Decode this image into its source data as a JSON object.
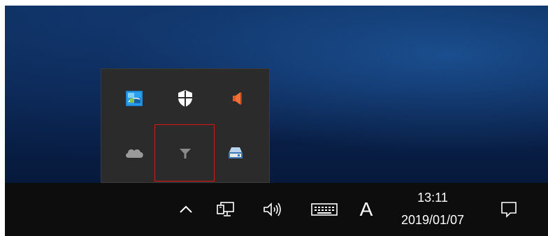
{
  "overflow_panel": {
    "icons": [
      {
        "name": "intel-graphics-icon"
      },
      {
        "name": "windows-security-icon"
      },
      {
        "name": "speaker-muted-icon"
      },
      {
        "name": "onedrive-cloud-icon"
      },
      {
        "name": "filter-icon",
        "highlighted": true
      },
      {
        "name": "removable-drive-icon"
      }
    ]
  },
  "taskbar": {
    "show_hidden_icons": "chevron-up-icon",
    "network": "network-icon",
    "volume": "volume-icon",
    "touch_keyboard": "keyboard-icon",
    "ime_mode": "A",
    "clock": {
      "time": "13:11",
      "date": "2019/01/07"
    },
    "action_center": "notification-icon"
  },
  "colors": {
    "taskbar_bg": "#0d0d0d",
    "panel_bg": "#2b2b2b",
    "highlight": "#e01414",
    "desktop": "#0a2450"
  }
}
